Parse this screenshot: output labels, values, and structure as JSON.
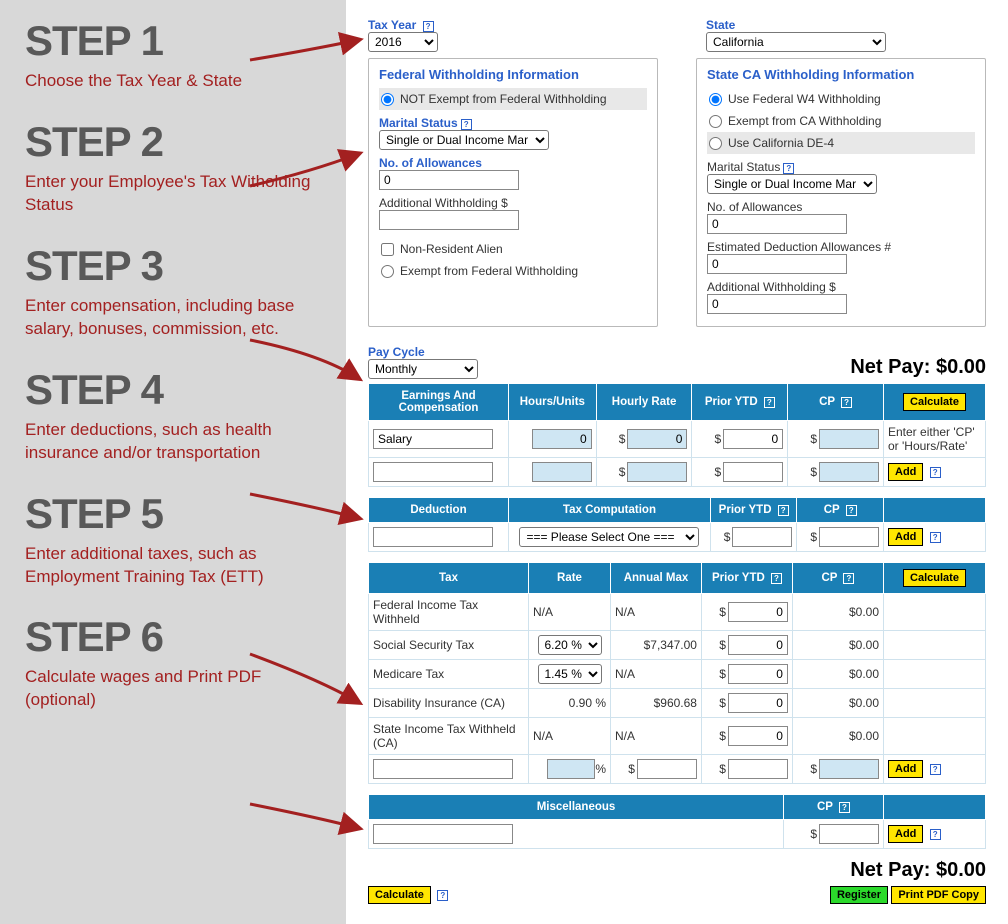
{
  "steps": {
    "s1t": "STEP 1",
    "s1d": "Choose the Tax Year & State",
    "s2t": "STEP 2",
    "s2d": "Enter your Employee's Tax Witholding Status",
    "s3t": "STEP 3",
    "s3d": "Enter compensation, including base salary, bonuses, commission, etc.",
    "s4t": "STEP 4",
    "s4d": "Enter deductions, such as health insurance and/or transportation",
    "s5t": "STEP 5",
    "s5d": "Enter additional taxes, such as Employment Training Tax (ETT)",
    "s6t": "STEP 6",
    "s6d": "Calculate wages and Print PDF (optional)"
  },
  "top": {
    "taxYearLabel": "Tax Year",
    "taxYearValue": "2016",
    "stateLabel": "State",
    "stateValue": "California"
  },
  "fed": {
    "title": "Federal Withholding Information",
    "opt1": "NOT Exempt from Federal Withholding",
    "msLabel": "Marital Status",
    "msValue": "Single or Dual Income Mar",
    "allowLabel": "No. of Allowances",
    "allowValue": "0",
    "addlLabel": "Additional Withholding $",
    "addlValue": "",
    "nra": "Non-Resident Alien",
    "opt2": "Exempt from Federal Withholding"
  },
  "st": {
    "title": "State CA Withholding Information",
    "r1": "Use Federal W4 Withholding",
    "r2": "Exempt from CA Withholding",
    "r3": "Use California DE-4",
    "msLabel": "Marital Status",
    "msValue": "Single or Dual Income Mar",
    "allowLabel": "No. of Allowances",
    "allowValue": "0",
    "edLabel": "Estimated Deduction Allowances #",
    "edValue": "0",
    "addlLabel": "Additional Withholding $",
    "addlValue": "0"
  },
  "cycle": {
    "label": "Pay Cycle",
    "value": "Monthly",
    "netLabel": "Net Pay: $0.00"
  },
  "eh": {
    "c1": "Earnings And Compensation",
    "c2": "Hours/Units",
    "c3": "Hourly Rate",
    "c4": "Prior YTD",
    "c5": "CP",
    "c6": "Calculate"
  },
  "e1": {
    "name": "Salary",
    "hu": "0",
    "hr": "0",
    "ytd": "0",
    "cp": "",
    "hint": "Enter either 'CP' or 'Hours/Rate'"
  },
  "e2": {
    "name": "",
    "hu": "",
    "hr": "",
    "ytd": "",
    "cp": "",
    "btn": "Add"
  },
  "dh": {
    "c1": "Deduction",
    "c2": "Tax Computation",
    "c3": "Prior YTD",
    "c4": "CP"
  },
  "d1": {
    "name": "",
    "sel": "=== Please Select One ===",
    "ytd": "",
    "cp": "",
    "btn": "Add"
  },
  "th": {
    "c1": "Tax",
    "c2": "Rate",
    "c3": "Annual Max",
    "c4": "Prior YTD",
    "c5": "CP",
    "c6": "Calculate"
  },
  "taxrows": {
    "r1n": "Federal Income Tax Withheld",
    "r1r": "N/A",
    "r1m": "N/A",
    "r1y": "0",
    "r1c": "$0.00",
    "r2n": "Social Security Tax",
    "r2r": "6.20 %",
    "r2m": "$7,347.00",
    "r2y": "0",
    "r2c": "$0.00",
    "r3n": "Medicare Tax",
    "r3r": "1.45 %",
    "r3m": "N/A",
    "r3y": "0",
    "r3c": "$0.00",
    "r4n": "Disability Insurance (CA)",
    "r4r": "0.90 %",
    "r4m": "$960.68",
    "r4y": "0",
    "r4c": "$0.00",
    "r5n": "State Income Tax Withheld (CA)",
    "r5r": "N/A",
    "r5m": "N/A",
    "r5y": "0",
    "r5c": "$0.00",
    "r6btn": "Add"
  },
  "mh": {
    "c1": "Miscellaneous",
    "c2": "CP"
  },
  "m1": {
    "name": "",
    "cp": "",
    "btn": "Add"
  },
  "bottom": {
    "net": "Net Pay: $0.00",
    "calc": "Calculate",
    "reg": "Register",
    "print": "Print PDF Copy"
  }
}
